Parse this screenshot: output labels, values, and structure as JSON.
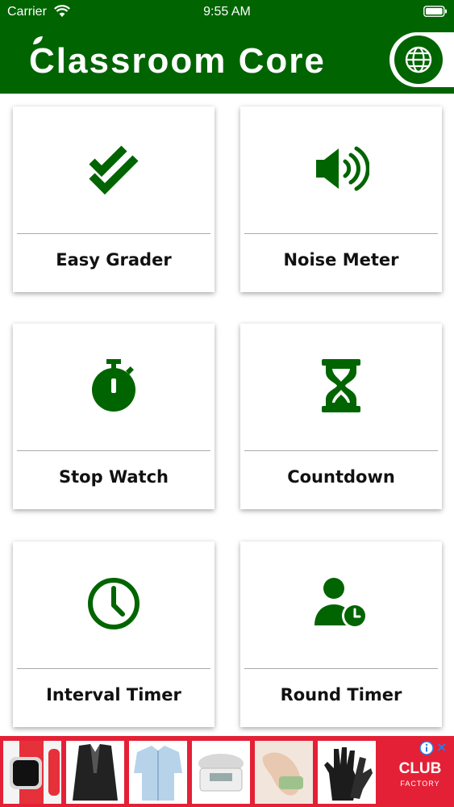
{
  "status_bar": {
    "carrier": "Carrier",
    "time": "9:55 AM"
  },
  "header": {
    "title": "Classroom Core",
    "globe_icon": "globe-icon"
  },
  "tools": [
    {
      "label": "Easy Grader",
      "icon": "double-check-icon"
    },
    {
      "label": "Noise Meter",
      "icon": "speaker-volume-icon"
    },
    {
      "label": "Stop Watch",
      "icon": "stopwatch-icon"
    },
    {
      "label": "Countdown",
      "icon": "hourglass-icon"
    },
    {
      "label": "Interval Timer",
      "icon": "clock-icon"
    },
    {
      "label": "Round Timer",
      "icon": "user-clock-icon"
    }
  ],
  "ad": {
    "brand_line1": "CLUB",
    "brand_line2": "FACTORY",
    "close": "×"
  },
  "colors": {
    "brand_green": "#006400",
    "ad_red": "#e42036"
  }
}
